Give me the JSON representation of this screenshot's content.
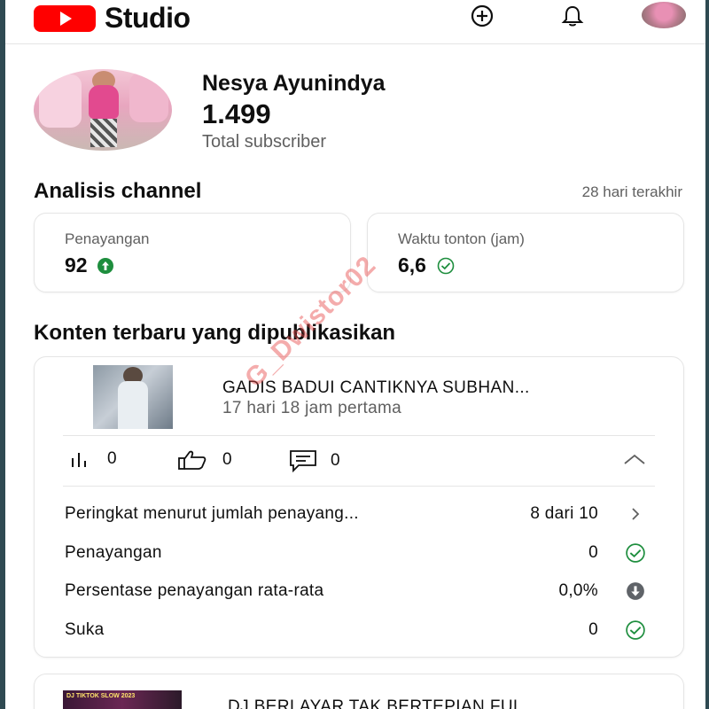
{
  "header": {
    "app_name": "Studio",
    "icons": [
      "youtube-logo",
      "create-icon",
      "bell-icon",
      "avatar"
    ]
  },
  "profile": {
    "channel_name": "Nesya Ayunindya",
    "subscriber_count": "1.499",
    "subscriber_label": "Total subscriber"
  },
  "analytics": {
    "title": "Analisis channel",
    "period": "28 hari terakhir",
    "cards": [
      {
        "label": "Penayangan",
        "value": "92",
        "indicator": "arrow-up-icon"
      },
      {
        "label": "Waktu tonton (jam)",
        "value": "6,6",
        "indicator": "check-circle-icon"
      }
    ]
  },
  "latest": {
    "title": "Konten terbaru yang dipublikasikan",
    "video": {
      "title": "GADIS BADUI CANTIKNYA SUBHAN...",
      "subtitle": "17 hari 18 jam pertama",
      "metrics": {
        "views": "0",
        "likes": "0",
        "comments": "0"
      },
      "rows": [
        {
          "label": "Peringkat menurut jumlah penayang...",
          "value": "8 dari 10",
          "icon": "chevron-right-icon"
        },
        {
          "label": "Penayangan",
          "value": "0",
          "icon": "check-circle-icon"
        },
        {
          "label": "Persentase penayangan rata-rata",
          "value": "0,0%",
          "icon": "arrow-down-circle-icon"
        },
        {
          "label": "Suka",
          "value": "0",
          "icon": "check-circle-icon"
        }
      ]
    },
    "video2": {
      "title": "DJ BERLAYAR TAK BERTEPIAN FUL...",
      "thumb_text": "DJ TIKTOK SLOW 2023"
    }
  },
  "watermark": "G_Dwistor02",
  "colors": {
    "brand_red": "#ff0000",
    "positive_green": "#1e8e3e",
    "text_secondary": "#606060"
  }
}
